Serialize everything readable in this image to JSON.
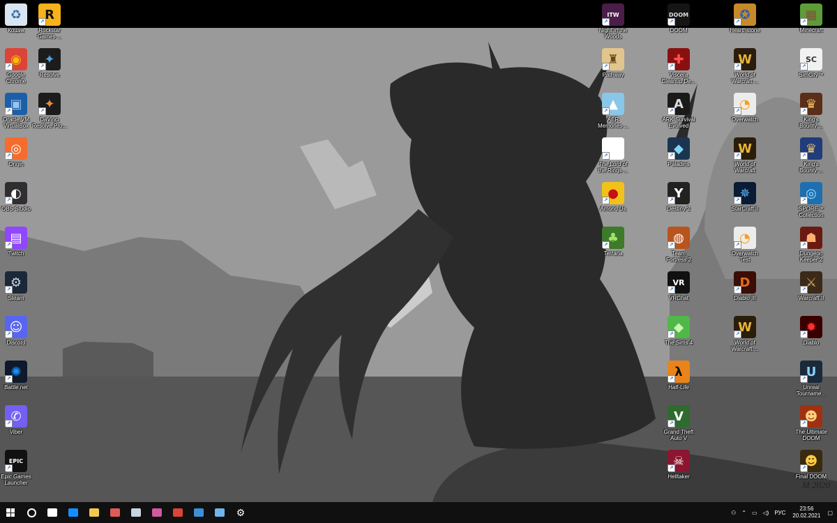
{
  "colors": {
    "taskbar": "#101010",
    "sky": "#9a9a9a",
    "ground": "#565656",
    "creature": "#2a2a2a"
  },
  "icons": {
    "left": [
      {
        "label": "Кошик",
        "icon": "recycle-bin-icon",
        "bg": "#d9e6f2",
        "glyph": "♻",
        "fg": "#3b6ea5"
      },
      {
        "label": "Rockstar\nGames ...",
        "icon": "rockstar-icon",
        "bg": "#f6b21a",
        "glyph": "R",
        "fg": "#111"
      },
      {
        "label": "Google\nChrome",
        "icon": "chrome-icon",
        "bg": "#db4437",
        "glyph": "◉",
        "fg": "#fbbc05"
      },
      {
        "label": "Resolve",
        "icon": "davinci-resolve-icon",
        "bg": "#1c1c1c",
        "glyph": "✦",
        "fg": "#4fa3e0"
      },
      {
        "label": "Oracle VM\nVirtualBox",
        "icon": "virtualbox-icon",
        "bg": "#1c5fa8",
        "glyph": "▣",
        "fg": "#9ac5f0"
      },
      {
        "label": "DaVinci\nResolve Pro...",
        "icon": "davinci-resolve-pro-icon",
        "bg": "#1c1c1c",
        "glyph": "✦",
        "fg": "#e88c3a"
      },
      {
        "label": "Origin",
        "icon": "origin-icon",
        "bg": "#f56c2d",
        "glyph": "◎",
        "fg": "#fff"
      },
      {
        "label": "OBS Studio",
        "icon": "obs-icon",
        "bg": "#302e31",
        "glyph": "◐",
        "fg": "#fff"
      },
      {
        "label": "Twitch",
        "icon": "twitch-icon",
        "bg": "#9146ff",
        "glyph": "▤",
        "fg": "#fff"
      },
      {
        "label": "Steam",
        "icon": "steam-icon",
        "bg": "#1b2838",
        "glyph": "⚙",
        "fg": "#c7d5e0"
      },
      {
        "label": "Discord",
        "icon": "discord-icon",
        "bg": "#5865f2",
        "glyph": "☺",
        "fg": "#fff"
      },
      {
        "label": "Battle.net",
        "icon": "battlenet-icon",
        "bg": "#0e1a2b",
        "glyph": "✺",
        "fg": "#148eff"
      },
      {
        "label": "Viber",
        "icon": "viber-icon",
        "bg": "#7360f2",
        "glyph": "✆",
        "fg": "#fff"
      },
      {
        "label": "Epic Games\nLauncher",
        "icon": "epic-games-icon",
        "bg": "#111",
        "glyph": "EPIC",
        "fg": "#fff"
      }
    ],
    "col_a": [
      {
        "label": "Night in the\nWoods",
        "icon": "night-in-the-woods-icon",
        "bg": "#4b1e4a",
        "glyph": "ITW",
        "fg": "#fff"
      },
      {
        "label": "Pathway",
        "icon": "pathway-icon",
        "bg": "#e2c58c",
        "glyph": "♜",
        "fg": "#6a4a1c"
      },
      {
        "label": "AER\nMemories ...",
        "icon": "aer-memories-icon",
        "bg": "#88c7e8",
        "glyph": "▲",
        "fg": "#fff"
      },
      {
        "label": "The Lord of\nthe Rings ...",
        "icon": "lotr-file-icon",
        "bg": "#ffffff",
        "glyph": "",
        "fg": "#999"
      },
      {
        "label": "Among Us",
        "icon": "among-us-icon",
        "bg": "#f2c21b",
        "glyph": "●",
        "fg": "#c51111"
      },
      {
        "label": "Terraria",
        "icon": "terraria-icon",
        "bg": "#3d7a2a",
        "glyph": "♣",
        "fg": "#a4e36b"
      }
    ],
    "col_b": [
      {
        "label": "DOOM",
        "icon": "doom-icon",
        "bg": "#151515",
        "glyph": "DOOM",
        "fg": "#ddd"
      },
      {
        "label": "Viscera\nCleanup De...",
        "icon": "viscera-cleanup-icon",
        "bg": "#8a1010",
        "glyph": "✚",
        "fg": "#ff5050"
      },
      {
        "label": "ARK Survival\nEvolved",
        "icon": "ark-icon",
        "bg": "#1a1a1a",
        "glyph": "A",
        "fg": "#ddd"
      },
      {
        "label": "Paladins",
        "icon": "paladins-icon",
        "bg": "#1b3550",
        "glyph": "◆",
        "fg": "#7fd6f5"
      },
      {
        "label": "Destiny 2",
        "icon": "destiny-icon",
        "bg": "#222",
        "glyph": "Y",
        "fg": "#fff"
      },
      {
        "label": "Team\nFortress 2",
        "icon": "tf2-icon",
        "bg": "#b8541d",
        "glyph": "◍",
        "fg": "#fff"
      },
      {
        "label": "VRChat",
        "icon": "vrchat-icon",
        "bg": "#111",
        "glyph": "VR",
        "fg": "#fff"
      },
      {
        "label": "The Sims 4",
        "icon": "sims-icon",
        "bg": "#4fb848",
        "glyph": "◆",
        "fg": "#c9f5b0"
      },
      {
        "label": "Half-Life",
        "icon": "half-life-icon",
        "bg": "#e8841a",
        "glyph": "λ",
        "fg": "#111"
      },
      {
        "label": "Grand Theft\nAuto V",
        "icon": "gta-v-icon",
        "bg": "#2e6b2e",
        "glyph": "V",
        "fg": "#fff"
      },
      {
        "label": "Helltaker",
        "icon": "helltaker-icon",
        "bg": "#8c1530",
        "glyph": "☠",
        "fg": "#fff"
      }
    ],
    "col_c": [
      {
        "label": "Hearthstone",
        "icon": "hearthstone-icon",
        "bg": "#c68a2a",
        "glyph": "✪",
        "fg": "#2e5fa8"
      },
      {
        "label": "World of\nWarcraft ...",
        "icon": "wow-icon",
        "bg": "#2b1d0c",
        "glyph": "W",
        "fg": "#e8b53a"
      },
      {
        "label": "Overwatch",
        "icon": "overwatch-icon",
        "bg": "#ececec",
        "glyph": "◔",
        "fg": "#f99e1a"
      },
      {
        "label": "World of\nWarcraft",
        "icon": "wow-icon",
        "bg": "#2b1d0c",
        "glyph": "W",
        "fg": "#e8b53a"
      },
      {
        "label": "StarCraft II",
        "icon": "starcraft-icon",
        "bg": "#0a1b33",
        "glyph": "✵",
        "fg": "#5ab4ff"
      },
      {
        "label": "Overwatch\nTest",
        "icon": "overwatch-test-icon",
        "bg": "#ececec",
        "glyph": "◔",
        "fg": "#f99e1a"
      },
      {
        "label": "Diablo III",
        "icon": "diablo3-icon",
        "bg": "#3a0d05",
        "glyph": "D",
        "fg": "#e26a1c"
      },
      {
        "label": "World of\nWarcraft ...",
        "icon": "wow-icon",
        "bg": "#2b1d0c",
        "glyph": "W",
        "fg": "#e8b53a"
      }
    ],
    "col_d": [
      {
        "label": "Minecraft",
        "icon": "minecraft-icon",
        "bg": "#5e9c3a",
        "glyph": "▦",
        "fg": "#7b5434"
      },
      {
        "label": "SimCity™",
        "icon": "simcity-icon",
        "bg": "#f1f1f1",
        "glyph": "SC",
        "fg": "#333"
      },
      {
        "label": "King's\nBounty ...",
        "icon": "kings-bounty-icon",
        "bg": "#5a2f1a",
        "glyph": "♛",
        "fg": "#f0c060"
      },
      {
        "label": "King's\nBounty ...",
        "icon": "kings-bounty-2-icon",
        "bg": "#213c7a",
        "glyph": "♛",
        "fg": "#f0c060"
      },
      {
        "label": "SPORE™\nCollection",
        "icon": "spore-icon",
        "bg": "#1d6fb0",
        "glyph": "◎",
        "fg": "#9ee0ff"
      },
      {
        "label": "Dungeon\nKeeper 2",
        "icon": "dungeon-keeper-icon",
        "bg": "#6a1a10",
        "glyph": "☗",
        "fg": "#ffb070"
      },
      {
        "label": "Warcraft II",
        "icon": "warcraft2-icon",
        "bg": "#3b2a1a",
        "glyph": "⚔",
        "fg": "#e0b060"
      },
      {
        "label": "Diablo",
        "icon": "diablo-icon",
        "bg": "#3a0000",
        "glyph": "✹",
        "fg": "#ff3030"
      },
      {
        "label": "Unreal\nTourname...",
        "icon": "unreal-tournament-icon",
        "bg": "#1a2a3a",
        "glyph": "U",
        "fg": "#8cd0ff"
      },
      {
        "label": "The Ultimate\nDOOM",
        "icon": "ultimate-doom-icon",
        "bg": "#a03010",
        "glyph": "☻",
        "fg": "#ffd080"
      },
      {
        "label": "Final DOOM",
        "icon": "final-doom-icon",
        "bg": "#3a2a10",
        "glyph": "☻",
        "fg": "#ffcc44"
      }
    ]
  },
  "taskbar": {
    "apps": [
      {
        "icon": "start-icon",
        "color": "#ffffff"
      },
      {
        "icon": "search-icon",
        "color": "#ffffff"
      },
      {
        "icon": "task-view-icon",
        "color": "#ffffff"
      },
      {
        "icon": "battlenet-taskbar-icon",
        "color": "#148eff"
      },
      {
        "icon": "file-explorer-icon",
        "color": "#f2c94c"
      },
      {
        "icon": "paint-icon",
        "color": "#e05a5a"
      },
      {
        "icon": "steam-taskbar-icon",
        "color": "#c7d5e0"
      },
      {
        "icon": "snipping-tool-icon",
        "color": "#d05aa0"
      },
      {
        "icon": "chrome-taskbar-icon",
        "color": "#db4437"
      },
      {
        "icon": "photos-icon",
        "color": "#3c8fd9"
      },
      {
        "icon": "notepad-icon",
        "color": "#6fb6e8"
      },
      {
        "icon": "settings-icon",
        "color": "#ffffff"
      }
    ],
    "language": "РУС",
    "time": "23:56",
    "date": "20.02.2021"
  },
  "signature": "M 2020"
}
